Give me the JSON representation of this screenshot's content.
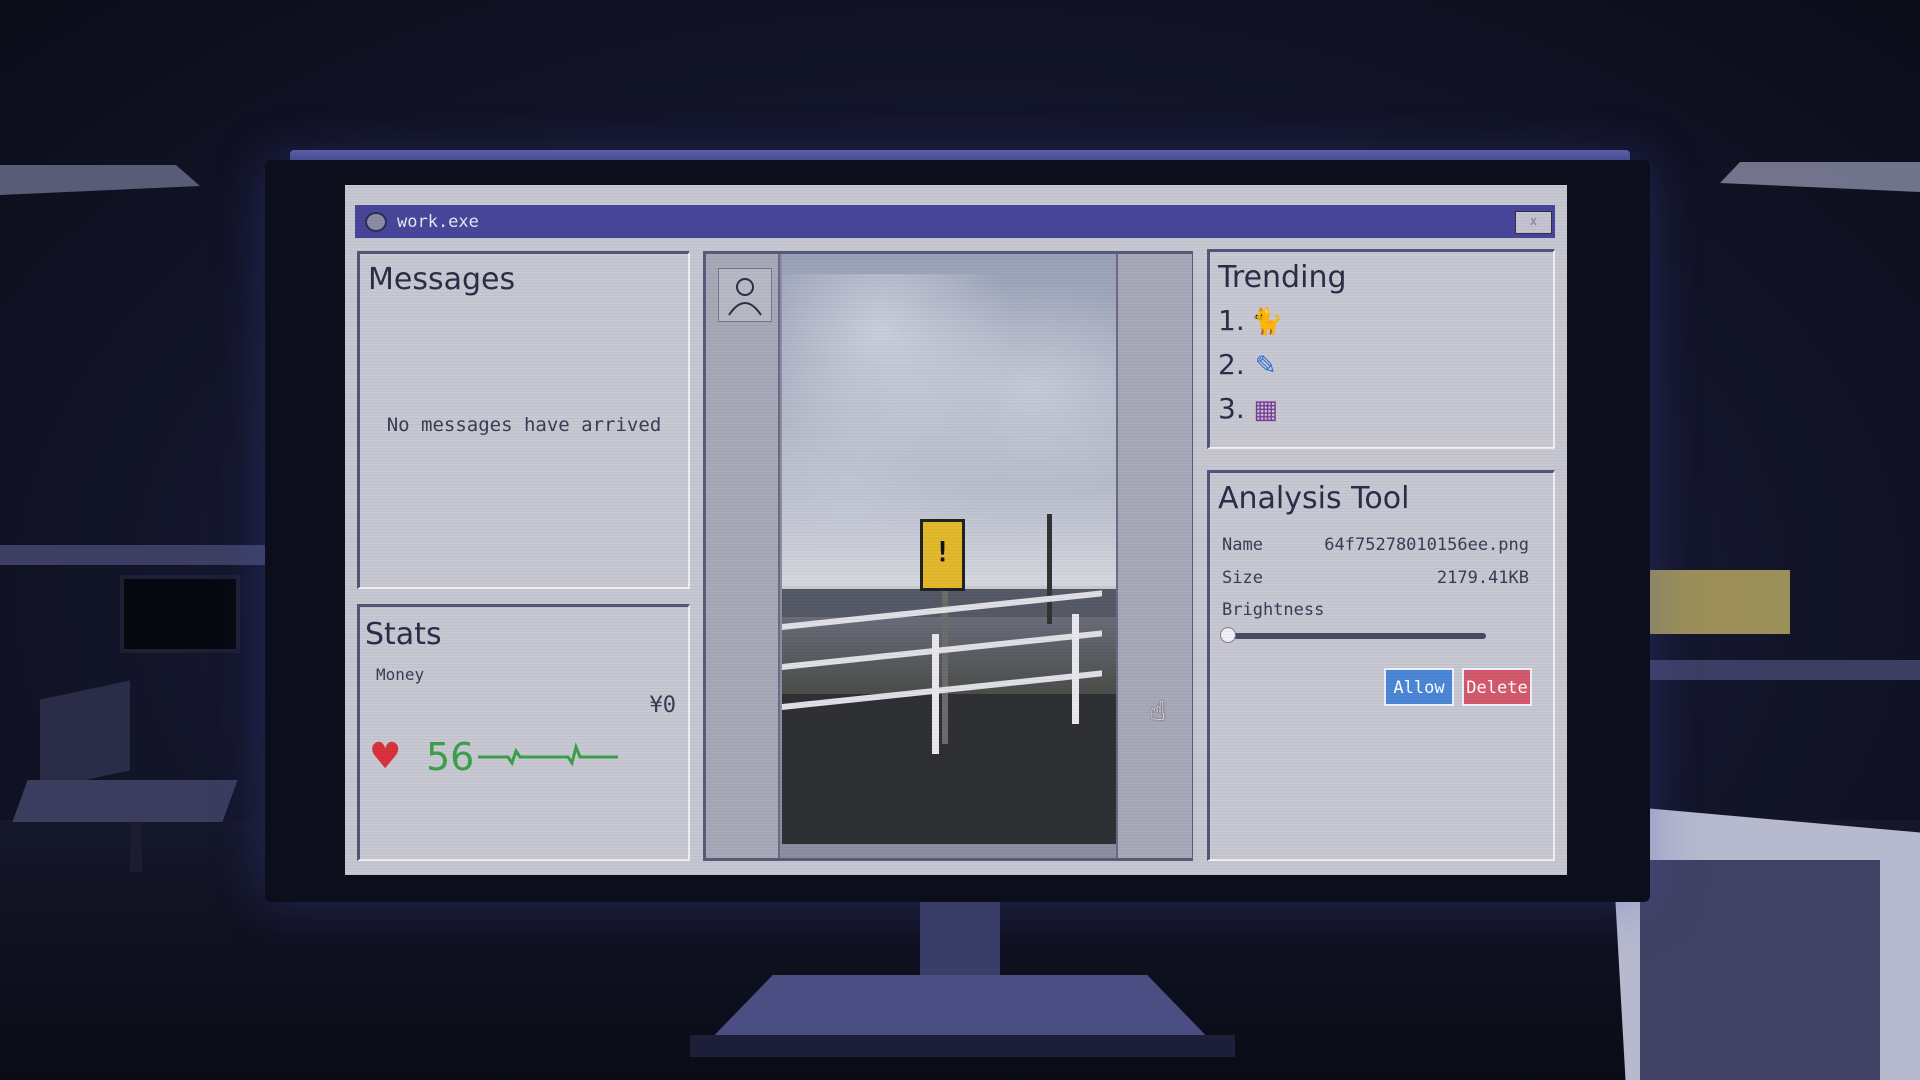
{
  "window": {
    "title": "work.exe",
    "close_label": "x"
  },
  "messages": {
    "title": "Messages",
    "empty_text": "No messages have arrived"
  },
  "stats": {
    "title": "Stats",
    "money_label": "Money",
    "money_value": "¥0",
    "health_value": "56"
  },
  "trending": {
    "title": "Trending",
    "items": [
      {
        "rank": "1.",
        "icon": "cat-icon"
      },
      {
        "rank": "2.",
        "icon": "pen-icon"
      },
      {
        "rank": "3.",
        "icon": "book-stack-icon"
      }
    ]
  },
  "analysis": {
    "title": "Analysis Tool",
    "name_label": "Name",
    "name_value": "64f75278010156ee.png",
    "size_label": "Size",
    "size_value": "2179.41KB",
    "brightness_label": "Brightness",
    "brightness_level": 0.0,
    "allow_label": "Allow",
    "delete_label": "Delete"
  },
  "colors": {
    "titlebar": "#47469a",
    "allow": "#4b86d6",
    "delete": "#d3596c",
    "health": "#3aa04c",
    "heart": "#d9323e"
  }
}
